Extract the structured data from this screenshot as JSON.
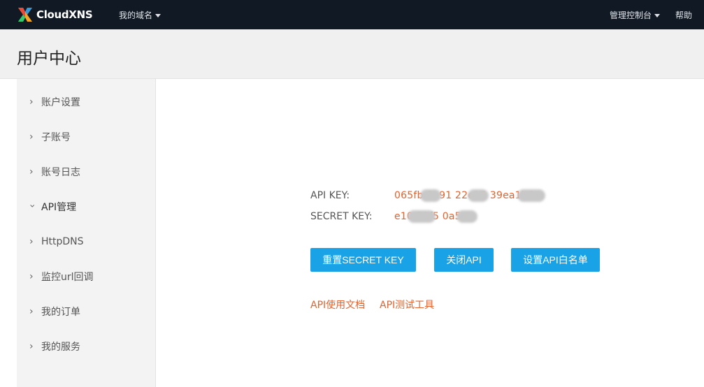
{
  "brand": {
    "name": "CloudXNS"
  },
  "topnav": {
    "domains": "我的域名",
    "console": "管理控制台",
    "help": "帮助"
  },
  "page": {
    "title": "用户中心"
  },
  "sidebar": {
    "items": [
      {
        "label": "账户设置",
        "active": false
      },
      {
        "label": "子账号",
        "active": false
      },
      {
        "label": "账号日志",
        "active": false
      },
      {
        "label": "API管理",
        "active": true
      },
      {
        "label": "HttpDNS",
        "active": false
      },
      {
        "label": "监控url回调",
        "active": false
      },
      {
        "label": "我的订单",
        "active": false
      },
      {
        "label": "我的服务",
        "active": false
      }
    ]
  },
  "api": {
    "key_label": "API KEY:",
    "key_value": "065fb   1e91    22e15    39ea1b6",
    "secret_label": "SECRET KEY:",
    "secret_value": "e10      53f5    0a5"
  },
  "buttons": {
    "reset_secret": "重置SECRET KEY",
    "close_api": "关闭API",
    "whitelist": "设置API白名单"
  },
  "links": {
    "docs": "API使用文档",
    "test_tool": "API测试工具"
  },
  "colors": {
    "topbar": "#111a24",
    "accent_button": "#1aa2e6",
    "link": "#e4622d"
  }
}
